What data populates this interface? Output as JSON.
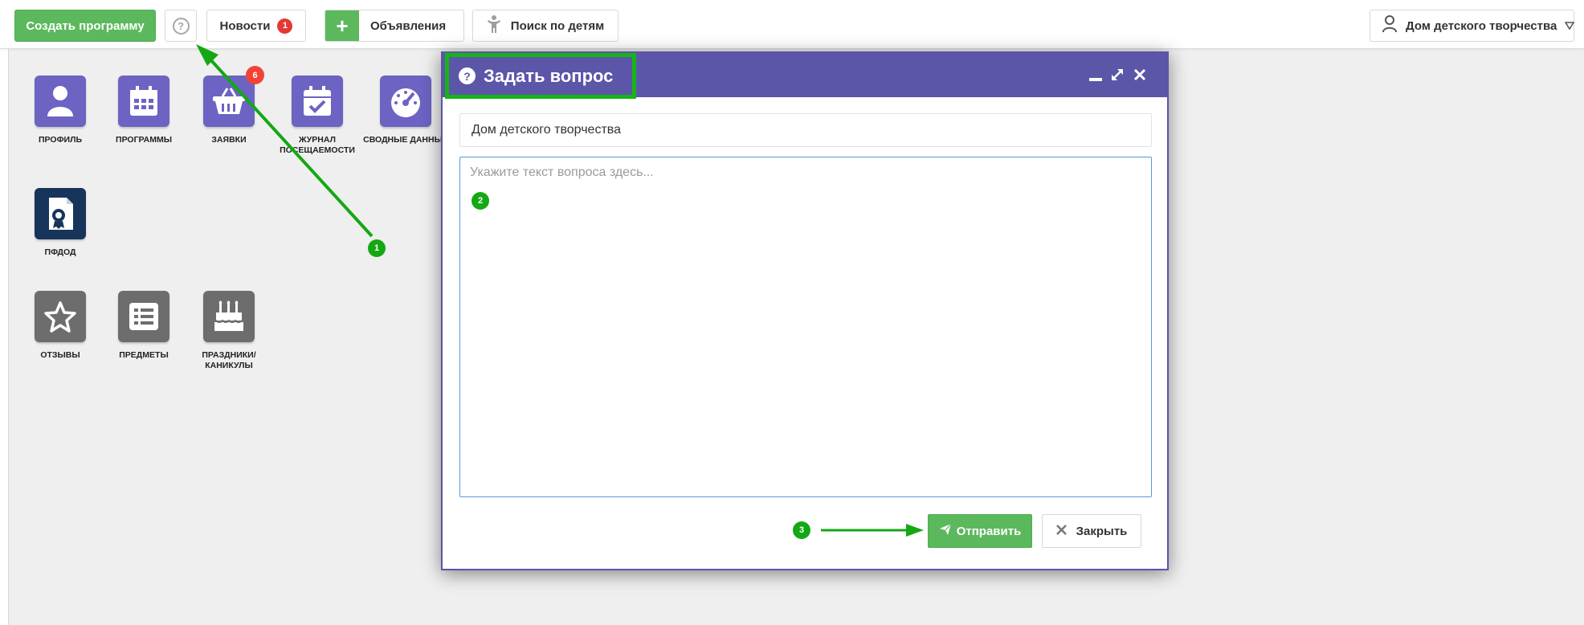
{
  "topbar": {
    "create_label": "Создать программу",
    "help_symbol": "?",
    "news_label": "Новости",
    "news_count": "1",
    "ads_plus": "+",
    "ads_label": "Объявления",
    "kids_label": "Поиск по детям",
    "org_label": "Дом детского творчества"
  },
  "tiles": [
    {
      "label": "Профиль",
      "icon": "user-icon"
    },
    {
      "label": "Программы",
      "icon": "calendar-icon"
    },
    {
      "label": "Заявки",
      "icon": "basket-icon",
      "badge": "6"
    },
    {
      "label": "Журнал посещаемости",
      "icon": "calendar-check-icon"
    },
    {
      "label": "Сводные данные",
      "icon": "gauge-icon"
    },
    {
      "label": "ПФДОД",
      "icon": "certificate-icon"
    },
    {
      "label": "Отзывы",
      "icon": "star-icon"
    },
    {
      "label": "Предметы",
      "icon": "list-icon"
    },
    {
      "label": "Праздники/ каникулы",
      "icon": "cake-icon"
    }
  ],
  "modal": {
    "title": "Задать вопрос",
    "org_value": "Дом детского творчества",
    "question_placeholder": "Укажите текст вопроса здесь...",
    "send_label": "Отправить",
    "close_label": "Закрыть"
  },
  "annotations": {
    "step1": "1",
    "step2": "2",
    "step3": "3",
    "color": "#14a814"
  },
  "colors": {
    "brand_green": "#5cb85c",
    "modal_header": "#5c56a8",
    "tile_purple": "#6c63c3",
    "tile_navy": "#17345a",
    "tile_gray": "#6d6d6d",
    "badge_red": "#f44336"
  }
}
